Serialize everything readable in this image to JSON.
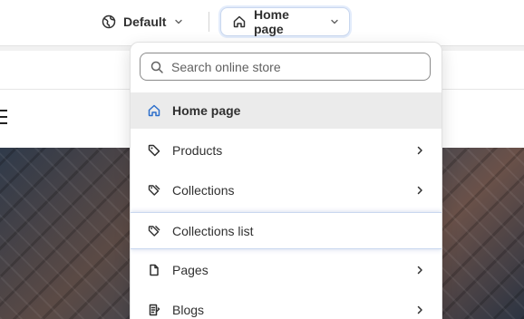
{
  "topbar": {
    "theme_label": "Default",
    "page_label": "Home page"
  },
  "dropdown": {
    "search_placeholder": "Search online store",
    "items": [
      {
        "label": "Home page",
        "icon": "home-icon",
        "selected": true,
        "has_submenu": false
      },
      {
        "label": "Products",
        "icon": "tag-icon",
        "selected": false,
        "has_submenu": true
      },
      {
        "label": "Collections",
        "icon": "tags-icon",
        "selected": false,
        "has_submenu": true
      },
      {
        "label": "Collections list",
        "icon": "tags-icon",
        "selected": false,
        "has_submenu": false
      },
      {
        "label": "Pages",
        "icon": "page-icon",
        "selected": false,
        "has_submenu": true
      },
      {
        "label": "Blogs",
        "icon": "blog-icon",
        "selected": false,
        "has_submenu": true
      }
    ]
  },
  "colors": {
    "accent": "#2c6ecb",
    "selected_bg": "#ebebeb",
    "text": "#303030"
  }
}
